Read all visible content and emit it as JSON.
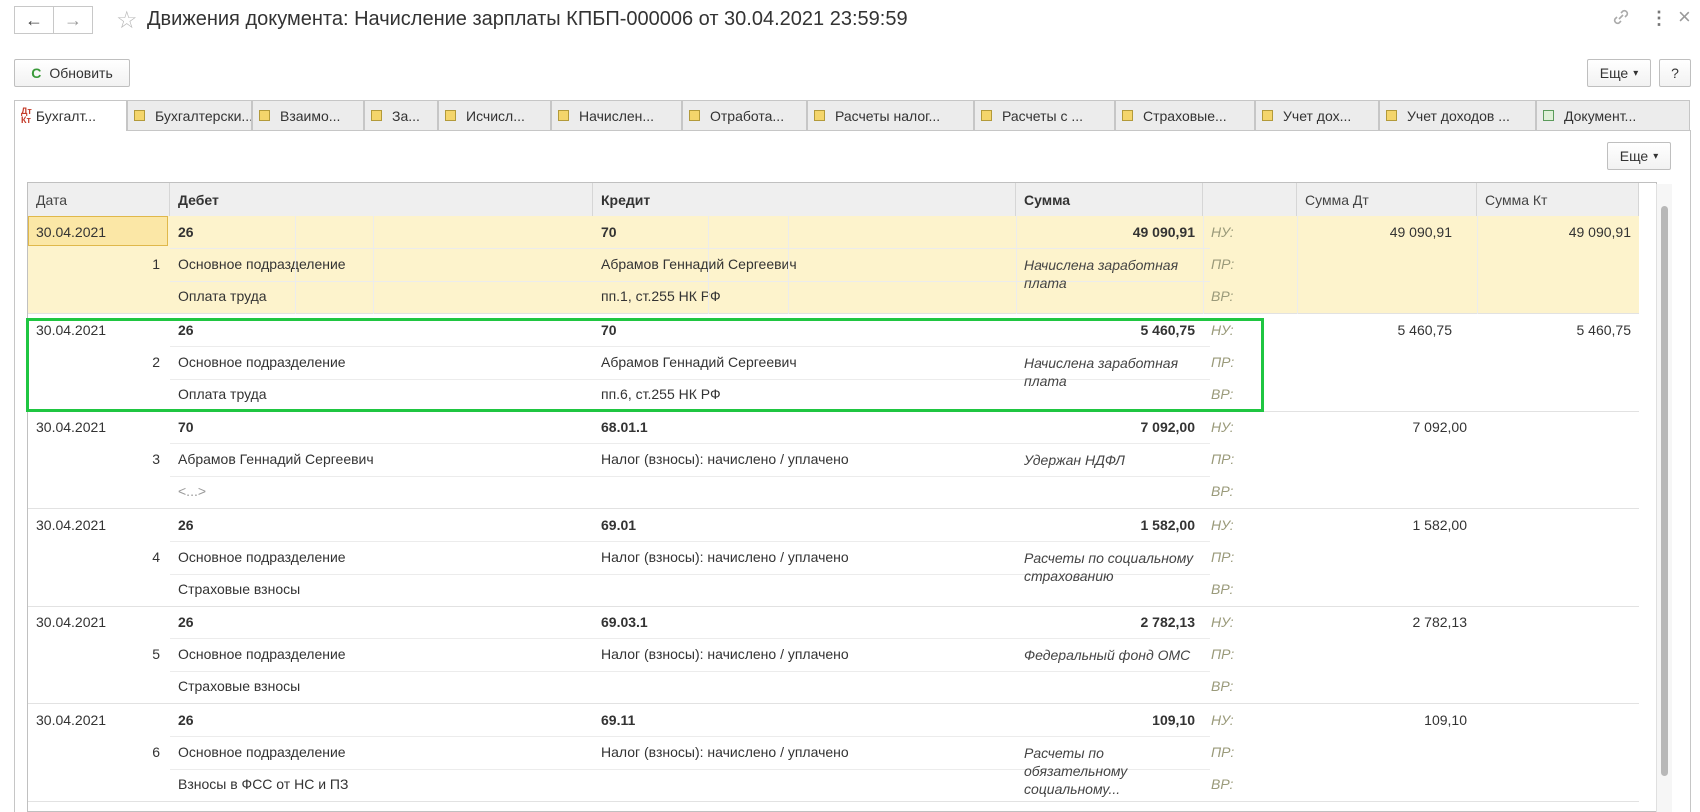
{
  "window": {
    "title": "Движения документа: Начисление зарплаты КПБП-000006 от 30.04.2021 23:59:59",
    "back_icon": "←",
    "forward_icon": "→",
    "star_icon": "☆",
    "link_icon": "🔗",
    "menu_icon": "⋮",
    "close_icon": "×"
  },
  "toolbar": {
    "refresh_label": "Обновить",
    "refresh_icon": "C",
    "more_label": "Еще",
    "help_label": "?"
  },
  "tabs": [
    {
      "label": "Бухгалт...",
      "icon_text": "Дт Кт"
    },
    {
      "label": "Бухгалтерски..."
    },
    {
      "label": "Взаимо..."
    },
    {
      "label": "За..."
    },
    {
      "label": "Исчисл..."
    },
    {
      "label": "Начислен..."
    },
    {
      "label": "Отработа..."
    },
    {
      "label": "Расчеты налог..."
    },
    {
      "label": "Расчеты с ..."
    },
    {
      "label": "Страховые..."
    },
    {
      "label": "Учет дох..."
    },
    {
      "label": "Учет доходов ..."
    },
    {
      "label": "Документ..."
    }
  ],
  "grid": {
    "more_label": "Еще",
    "headers": [
      "Дата",
      "Дебет",
      "Кредит",
      "Сумма",
      "",
      "Сумма Дт",
      "Сумма Кт"
    ],
    "labels": {
      "nu": "НУ:",
      "pr": "ПР:",
      "vr": "ВР:"
    },
    "rows": [
      {
        "date": "30.04.2021",
        "num": "1",
        "debit": "26",
        "debit_sub1": "Основное подразделение",
        "debit_sub2": "Оплата труда",
        "credit": "70",
        "credit_sub1": "Абрамов Геннадий Сергеевич",
        "credit_sub2": "пп.1, ст.255 НК РФ",
        "sum": "49 090,91",
        "content": "Начислена заработная плата",
        "sum_dt": "49 090,91",
        "sum_kt": "49 090,91"
      },
      {
        "date": "30.04.2021",
        "num": "2",
        "debit": "26",
        "debit_sub1": "Основное подразделение",
        "debit_sub2": "Оплата труда",
        "credit": "70",
        "credit_sub1": "Абрамов Геннадий Сергеевич",
        "credit_sub2": "пп.6, ст.255 НК РФ",
        "sum": "5 460,75",
        "content": "Начислена заработная плата",
        "sum_dt": "5 460,75",
        "sum_kt": "5 460,75"
      },
      {
        "date": "30.04.2021",
        "num": "3",
        "debit": "70",
        "debit_sub1": "Абрамов Геннадий Сергеевич",
        "debit_sub2": "<...>",
        "credit": "68.01.1",
        "credit_sub1": "Налог (взносы): начислено / уплачено",
        "credit_sub2": "",
        "sum": "7 092,00",
        "content": "Удержан НДФЛ",
        "sum_dt": "7 092,00",
        "sum_kt": ""
      },
      {
        "date": "30.04.2021",
        "num": "4",
        "debit": "26",
        "debit_sub1": "Основное подразделение",
        "debit_sub2": "Страховые взносы",
        "credit": "69.01",
        "credit_sub1": "Налог (взносы): начислено / уплачено",
        "credit_sub2": "",
        "sum": "1 582,00",
        "content": "Расчеты по социальному страхованию",
        "sum_dt": "1 582,00",
        "sum_kt": ""
      },
      {
        "date": "30.04.2021",
        "num": "5",
        "debit": "26",
        "debit_sub1": "Основное подразделение",
        "debit_sub2": "Страховые взносы",
        "credit": "69.03.1",
        "credit_sub1": "Налог (взносы): начислено / уплачено",
        "credit_sub2": "",
        "sum": "2 782,13",
        "content": "Федеральный фонд ОМС",
        "sum_dt": "2 782,13",
        "sum_kt": ""
      },
      {
        "date": "30.04.2021",
        "num": "6",
        "debit": "26",
        "debit_sub1": "Основное подразделение",
        "debit_sub2": "Взносы в ФСС от НС и ПЗ",
        "credit": "69.11",
        "credit_sub1": "Налог (взносы): начислено / уплачено",
        "credit_sub2": "",
        "sum": "109,10",
        "content": "Расчеты по обязательному социальному...",
        "sum_dt": "109,10",
        "sum_kt": ""
      }
    ]
  },
  "colors": {
    "selected_row": "#fdf3cc",
    "highlight_border": "#1fc641",
    "refresh_icon": "#3a9a3a"
  }
}
